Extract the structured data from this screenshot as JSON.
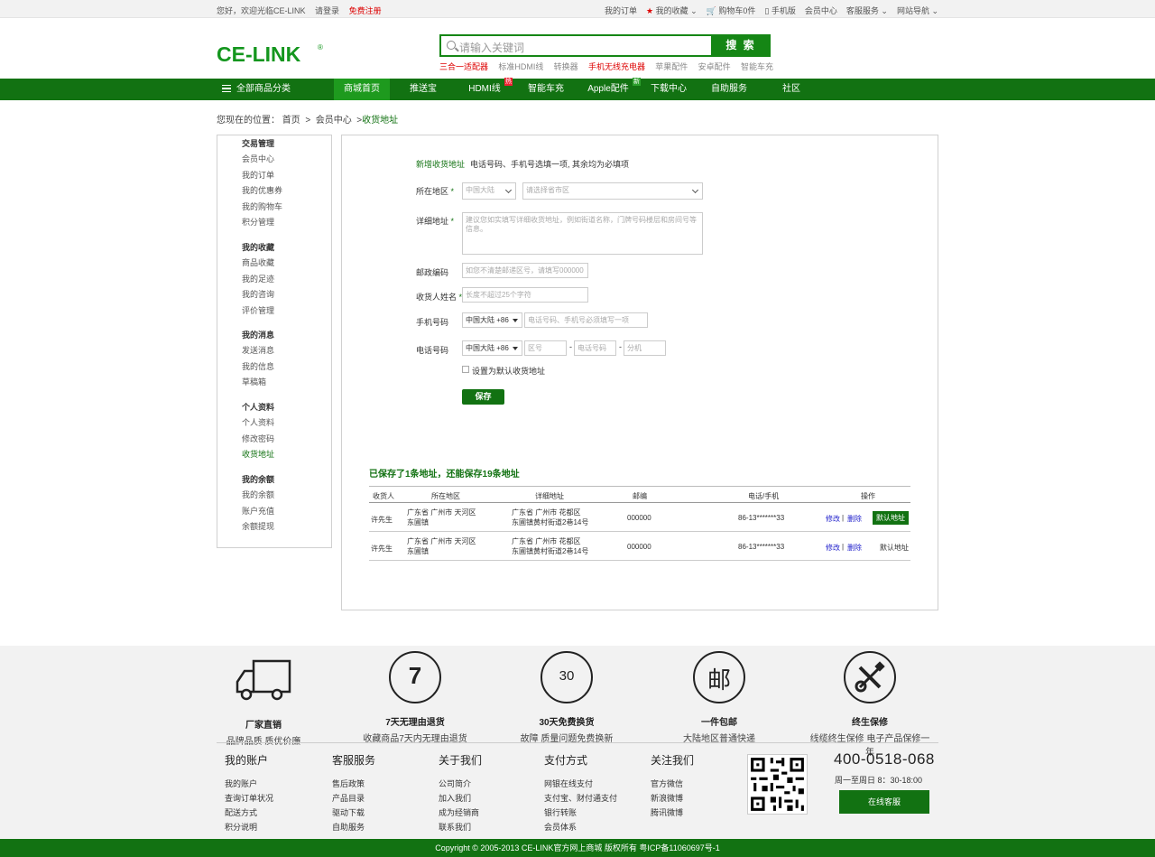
{
  "topbar": {
    "welcome": "您好，欢迎光临CE-LINK",
    "login": "请登录",
    "register": "免费注册",
    "links": [
      "我的订单",
      "我的收藏",
      "购物车0件",
      "手机版",
      "会员中心",
      "客服服务",
      "网站导航"
    ]
  },
  "logo": {
    "text": "CE-LINK",
    "brand_color": "#14961e"
  },
  "search": {
    "placeholder": "请输入关键词",
    "button": "搜 索"
  },
  "hot_words": [
    "三合一适配器",
    "标准HDMI线",
    "转换器",
    "手机无线充电器",
    "苹果配件",
    "安卓配件",
    "智能车充"
  ],
  "nav": {
    "all_categories": "全部商品分类",
    "items": [
      {
        "label": "商城首页",
        "active": true
      },
      {
        "label": "推送宝"
      },
      {
        "label": "HDMI线",
        "badge": "热"
      },
      {
        "label": "智能车充"
      },
      {
        "label": "Apple配件",
        "badge": "新"
      },
      {
        "label": "下载中心"
      },
      {
        "label": "自助服务"
      },
      {
        "label": "社区"
      }
    ]
  },
  "breadcrumb": {
    "prefix": "您现在的位置：",
    "items": [
      "首页",
      "会员中心",
      "收货地址"
    ]
  },
  "sidebar": {
    "groups": [
      {
        "title": "交易管理",
        "items": [
          "会员中心",
          "我的订单",
          "我的优惠券",
          "我的购物车",
          "积分管理"
        ]
      },
      {
        "title": "我的收藏",
        "items": [
          "商品收藏",
          "我的足迹",
          "我的咨询",
          "评价管理"
        ]
      },
      {
        "title": "我的消息",
        "items": [
          "发送消息",
          "我的信息",
          "草稿箱"
        ]
      },
      {
        "title": "个人资料",
        "items": [
          "个人资料",
          "修改密码",
          "收货地址"
        ]
      },
      {
        "title": "我的余额",
        "items": [
          "我的余额",
          "账户充值",
          "余额提现"
        ]
      }
    ],
    "active": "收货地址"
  },
  "form": {
    "heading": "新增收货地址",
    "note": "电话号码、手机号选填一项, 其余均为必填项",
    "region_label": "所在地区",
    "region_country": "中国大陆",
    "region_placeholder": "请选择省市区",
    "address_label": "详细地址",
    "address_placeholder": "建议您如实填写详细收货地址，例如街道名称，门牌号码楼层和房间号等信息。",
    "zip_label": "邮政编码",
    "zip_placeholder": "如您不清楚邮递区号，请填写000000",
    "name_label": "收货人姓名",
    "name_placeholder": "长度不超过25个字符",
    "mobile_label": "手机号码",
    "mobile_code": "中国大陆 +86",
    "mobile_placeholder": "电话号码、手机号必须填写一项",
    "phone_label": "电话号码",
    "phone_code": "中国大陆 +86",
    "phone_area": "区号",
    "phone_number": "电话号码",
    "phone_ext": "分机",
    "default_label": "设置为默认收货地址",
    "save": "保存"
  },
  "saved": {
    "title": "已保存了1条地址，还能保存19条地址",
    "headers": [
      "收货人",
      "所在地区",
      "详细地址",
      "邮编",
      "电话/手机",
      "操作"
    ],
    "rows": [
      {
        "name": "许先生",
        "region": [
          "广东省  广州市  天河区",
          "东圃镇"
        ],
        "address": [
          "广东省  广州市   花都区",
          "东圃镇黄村街道2巷14号"
        ],
        "zip": "000000",
        "phone": "86-13*******33",
        "edit": "修改",
        "delete": "删除",
        "default": "默认地址",
        "is_default": true
      },
      {
        "name": "许先生",
        "region": [
          "广东省  广州市  天河区",
          "东圃镇"
        ],
        "address": [
          "广东省  广州市   花都区",
          "东圃镇黄村街道2巷14号"
        ],
        "zip": "000000",
        "phone": "86-13*******33",
        "edit": "修改",
        "delete": "删除",
        "default": "默认地址",
        "is_default": false
      }
    ]
  },
  "features": [
    {
      "icon": "truck-icon",
      "title": "厂家直销",
      "desc": "品牌品质  质优价廉"
    },
    {
      "icon": "seven-day-icon",
      "glyph": "7",
      "title": "7天无理由退货",
      "desc": "收藏商品7天内无理由退货"
    },
    {
      "icon": "thirty-day-icon",
      "glyph": "30",
      "title": "30天免费换货",
      "desc": "故障  质量问题免费换新"
    },
    {
      "icon": "mail-icon",
      "glyph": "邮",
      "title": "一件包邮",
      "desc": "大陆地区普通快递"
    },
    {
      "icon": "tools-icon",
      "title": "终生保修",
      "desc": "线缆终生保修  电子产品保修一年"
    }
  ],
  "footer_cols": [
    {
      "title": "我的账户",
      "links": [
        "我的账户",
        "查询订单状况",
        "配送方式",
        "积分说明"
      ]
    },
    {
      "title": "客服服务",
      "links": [
        "售后政策",
        "产品目录",
        "驱动下载",
        "自助服务"
      ]
    },
    {
      "title": "关于我们",
      "links": [
        "公司简介",
        "加入我们",
        "成为经销商",
        "联系我们"
      ]
    },
    {
      "title": "支付方式",
      "links": [
        "网银在线支付",
        "支付宝、财付通支付",
        "银行转账",
        "会员体系"
      ]
    },
    {
      "title": "关注我们",
      "links": [
        "官方微信",
        "新浪微博",
        "腾讯微博"
      ]
    }
  ],
  "contact": {
    "phone": "400-0518-068",
    "hours": "周一至周日  8：30-18:00",
    "online": "在线客服"
  },
  "copyright": "Copyright © 2005-2013 CE-LINK官方网上商城 版权所有 粤ICP备11060697号-1"
}
